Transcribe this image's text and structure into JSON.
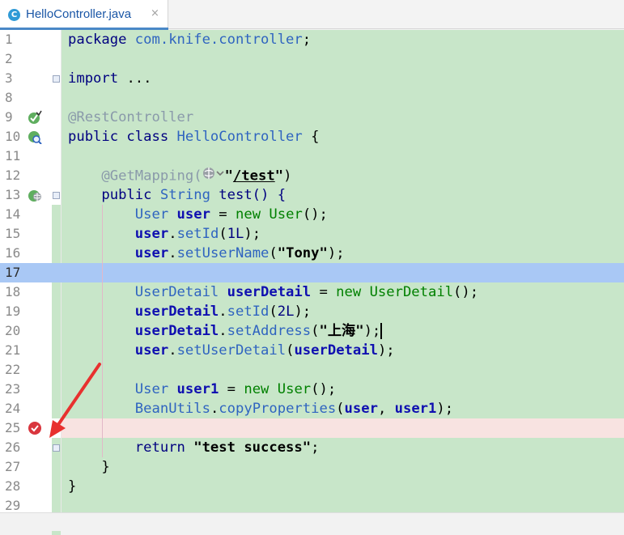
{
  "tab": {
    "icon_letter": "C",
    "title": "HelloController.java",
    "close_glyph": "×"
  },
  "lines": [
    {
      "n": "1",
      "t": [
        [
          "kw",
          "package "
        ],
        [
          "pkg",
          "com.knife.controller"
        ],
        [
          "p",
          ";"
        ]
      ]
    },
    {
      "n": "2",
      "t": []
    },
    {
      "n": "3",
      "t": [
        [
          "kw",
          "import "
        ],
        [
          "p",
          "..."
        ]
      ]
    },
    {
      "n": "8",
      "t": []
    },
    {
      "n": "9",
      "t": [
        [
          "ann",
          "@RestController"
        ]
      ]
    },
    {
      "n": "10",
      "t": [
        [
          "kw",
          "public class "
        ],
        [
          "cls",
          "HelloController"
        ],
        [
          "p",
          " {"
        ]
      ]
    },
    {
      "n": "11",
      "t": []
    },
    {
      "n": "12",
      "t": [
        [
          "p",
          "    "
        ],
        [
          "ann",
          "@GetMapping("
        ],
        [
          "ann",
          "@web@"
        ],
        [
          "str",
          "\""
        ],
        [
          "str u",
          "/test"
        ],
        [
          "str",
          "\""
        ],
        [
          "p",
          ")"
        ]
      ]
    },
    {
      "n": "13",
      "t": [
        [
          "p",
          "    "
        ],
        [
          "kw",
          "public "
        ],
        [
          "ty",
          "String "
        ],
        [
          "kw",
          "test() {"
        ]
      ]
    },
    {
      "n": "14",
      "t": [
        [
          "p",
          "        "
        ],
        [
          "ty",
          "User "
        ],
        [
          "var",
          "user "
        ],
        [
          "p",
          "= "
        ],
        [
          "nw",
          "new "
        ],
        [
          "nw",
          "User"
        ],
        [
          "p",
          "();"
        ]
      ]
    },
    {
      "n": "15",
      "t": [
        [
          "p",
          "        "
        ],
        [
          "var",
          "user"
        ],
        [
          "p",
          "."
        ],
        [
          "mth",
          "setId"
        ],
        [
          "p",
          "("
        ],
        [
          "num",
          "1L"
        ],
        [
          "p",
          ");"
        ]
      ]
    },
    {
      "n": "16",
      "t": [
        [
          "p",
          "        "
        ],
        [
          "var",
          "user"
        ],
        [
          "p",
          "."
        ],
        [
          "mth",
          "setUserName"
        ],
        [
          "p",
          "("
        ],
        [
          "str",
          "\"Tony\""
        ],
        [
          "p",
          ");"
        ]
      ]
    },
    {
      "n": "17",
      "t": []
    },
    {
      "n": "18",
      "t": [
        [
          "p",
          "        "
        ],
        [
          "ty",
          "UserDetail "
        ],
        [
          "var",
          "userDetail "
        ],
        [
          "p",
          "= "
        ],
        [
          "nw",
          "new "
        ],
        [
          "nw",
          "UserDetail"
        ],
        [
          "p",
          "();"
        ]
      ]
    },
    {
      "n": "19",
      "t": [
        [
          "p",
          "        "
        ],
        [
          "var",
          "userDetail"
        ],
        [
          "p",
          "."
        ],
        [
          "mth",
          "setId"
        ],
        [
          "p",
          "("
        ],
        [
          "num",
          "2L"
        ],
        [
          "p",
          ");"
        ]
      ]
    },
    {
      "n": "20",
      "t": [
        [
          "p",
          "        "
        ],
        [
          "var",
          "userDetail"
        ],
        [
          "p",
          "."
        ],
        [
          "mth",
          "setAddress"
        ],
        [
          "p",
          "("
        ],
        [
          "str",
          "\"上海\""
        ],
        [
          "p",
          ");"
        ],
        [
          "cursor",
          ""
        ]
      ]
    },
    {
      "n": "21",
      "t": [
        [
          "p",
          "        "
        ],
        [
          "var",
          "user"
        ],
        [
          "p",
          "."
        ],
        [
          "mth",
          "setUserDetail"
        ],
        [
          "p",
          "("
        ],
        [
          "var",
          "userDetail"
        ],
        [
          "p",
          ");"
        ]
      ]
    },
    {
      "n": "22",
      "t": []
    },
    {
      "n": "23",
      "t": [
        [
          "p",
          "        "
        ],
        [
          "ty",
          "User "
        ],
        [
          "var",
          "user1 "
        ],
        [
          "p",
          "= "
        ],
        [
          "nw",
          "new "
        ],
        [
          "nw",
          "User"
        ],
        [
          "p",
          "();"
        ]
      ]
    },
    {
      "n": "24",
      "t": [
        [
          "p",
          "        "
        ],
        [
          "cls",
          "BeanUtils"
        ],
        [
          "p",
          "."
        ],
        [
          "mth",
          "copyProperties"
        ],
        [
          "p",
          "("
        ],
        [
          "var",
          "user"
        ],
        [
          "p",
          ", "
        ],
        [
          "var",
          "user1"
        ],
        [
          "p",
          ");"
        ]
      ]
    },
    {
      "n": "25",
      "t": []
    },
    {
      "n": "26",
      "t": [
        [
          "p",
          "        "
        ],
        [
          "kw",
          "return "
        ],
        [
          "str",
          "\"test success\""
        ],
        [
          "p",
          ";"
        ]
      ]
    },
    {
      "n": "27",
      "t": [
        [
          "p",
          "    }"
        ]
      ]
    },
    {
      "n": "28",
      "t": [
        [
          "p",
          "}"
        ]
      ]
    },
    {
      "n": "29",
      "t": []
    }
  ],
  "current_line_index": 12,
  "breakpoint_line_index": 20,
  "colors": {
    "changed_bg": "#c8e6c9",
    "current_line_bg": "#a9c8f5",
    "breakpoint_line_bg": "#f8e3e1",
    "breakpoint": "#d9363e",
    "arrow": "#e8312f"
  },
  "gutter_icons": [
    {
      "line_index": 4,
      "icon": "bean-check-icon"
    },
    {
      "line_index": 5,
      "icon": "bean-search-icon"
    },
    {
      "line_index": 8,
      "icon": "web-endpoint-icon"
    },
    {
      "line_index": 20,
      "icon": "breakpoint-checked-icon"
    }
  ]
}
